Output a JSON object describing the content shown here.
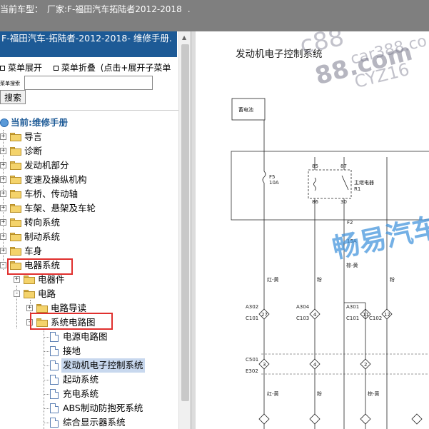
{
  "topbar": {
    "label": "当前车型：",
    "value": "厂家:F-福田汽车拓陆者2012-2018",
    "tail": "."
  },
  "manual": {
    "title": "F-福田汽车-拓陆者-2012-2018- 维修手册."
  },
  "controls": {
    "expand_label": "菜单展开",
    "collapse_label": "菜单折叠",
    "collapse_hint": "(点击+展开子菜单",
    "search_label": "菜单搜索",
    "search_value": "",
    "search_button": "搜索"
  },
  "tree": {
    "root_label": "当前:维修手册",
    "items": [
      {
        "label": "导言"
      },
      {
        "label": "诊断"
      },
      {
        "label": "发动机部分"
      },
      {
        "label": "变速及操纵机构"
      },
      {
        "label": "车桥、传动轴"
      },
      {
        "label": "车架、悬架及车轮"
      },
      {
        "label": "转向系统"
      },
      {
        "label": "制动系统"
      },
      {
        "label": "车身"
      },
      {
        "label": "电器系统"
      },
      {
        "label": "电器件"
      },
      {
        "label": "电路"
      },
      {
        "label": "电路导读"
      },
      {
        "label": "系统电路图"
      },
      {
        "label": "电源电路图"
      },
      {
        "label": "接地"
      },
      {
        "label": "发动机电子控制系统"
      },
      {
        "label": "起动系统"
      },
      {
        "label": "充电系统"
      },
      {
        "label": "ABS制动防抱死系统"
      },
      {
        "label": "综合显示器系统"
      }
    ]
  },
  "doc": {
    "title": "发动机电子控制系统",
    "watermark_main": "88.com",
    "watermark_top": "c88",
    "watermark_right": "car388.co",
    "watermark_cyz": "CYZ16",
    "watermark_cn": "畅易汽车",
    "battery_label": "蓄电池",
    "fuse_f5": "F5",
    "fuse_f5_rating": "10A",
    "relay_label": "主继电器",
    "relay_id": "R1",
    "pin_85": "85",
    "pin_87": "87",
    "pin_86": "86",
    "pin_30": "30",
    "fuse_f2": "F2",
    "fuse_f2_rating": "15A",
    "wire_red_yellow": "红-黄",
    "wire_brown_yellow": "棕-黄",
    "wire_pink": "粉",
    "conn_a302": "A302",
    "conn_c101a": "C101",
    "conn_a304": "A304",
    "conn_c103": "C103",
    "conn_a301": "A301",
    "conn_c101b": "C101",
    "conn_c102": "C102",
    "conn_c501": "C501",
    "conn_e302": "E302",
    "pin_27": "27",
    "pin_4": "4",
    "pin_11": "11",
    "pin_12": "12",
    "pin_3": "3",
    "pin_2": "2"
  }
}
